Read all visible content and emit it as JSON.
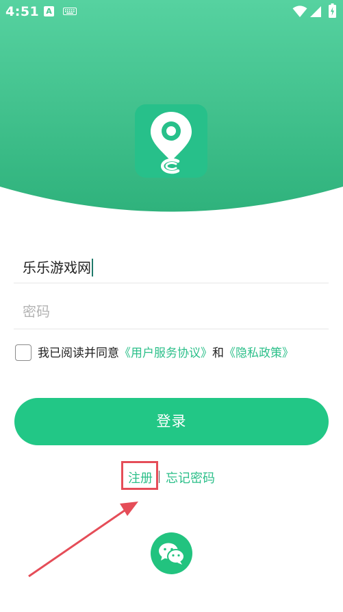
{
  "status_bar": {
    "time": "4:51",
    "notification_icon_letter": "A",
    "icons": [
      "a-notification-icon",
      "keyboard-icon",
      "wifi-icon",
      "signal-icon",
      "battery-charging-icon"
    ]
  },
  "app": {
    "logo_icon": "location-pin-logo-icon"
  },
  "login_form": {
    "username_value": "乐乐游戏网",
    "password_placeholder": "密码",
    "agreement": {
      "checked": false,
      "prefix": "我已阅读并同意",
      "terms_link": "《用户服务协议》",
      "conjunction": "和",
      "privacy_link": "《隐私政策》"
    },
    "login_label": "登录"
  },
  "links": {
    "register": "注册",
    "divider": "|",
    "forgot_password": "忘记密码"
  },
  "social": {
    "wechat_icon": "wechat-icon"
  },
  "colors": {
    "brand_green": "#22c786",
    "header_gradient_top": "#56d2a0",
    "header_gradient_bottom": "#2fb27c",
    "link_green": "#2bbf89",
    "annotation_red": "#e54d58"
  }
}
